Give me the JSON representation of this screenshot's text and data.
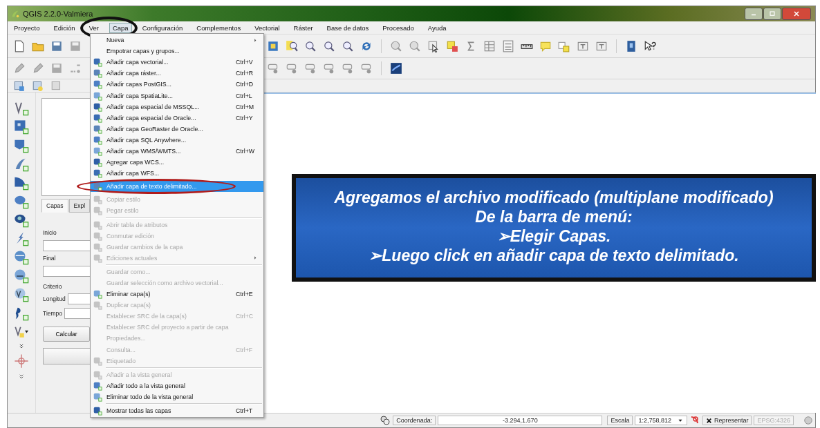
{
  "window": {
    "title": "QGIS 2.2.0-Valmiera"
  },
  "menubar": [
    {
      "label": "Proyecto",
      "selected": false
    },
    {
      "label": "Edición",
      "selected": false
    },
    {
      "label": "Ver",
      "selected": false
    },
    {
      "label": "Capa",
      "selected": true
    },
    {
      "label": "Configuración",
      "selected": false
    },
    {
      "label": "Complementos",
      "selected": false
    },
    {
      "label": "Vectorial",
      "selected": false
    },
    {
      "label": "Ráster",
      "selected": false
    },
    {
      "label": "Base de datos",
      "selected": false
    },
    {
      "label": "Procesado",
      "selected": false
    },
    {
      "label": "Ayuda",
      "selected": false
    }
  ],
  "layer_menu": {
    "items": [
      {
        "kind": "item",
        "label": "Nueva",
        "icon": false,
        "submenu": true,
        "disabled": false,
        "selected": false
      },
      {
        "kind": "item",
        "label": "Empotrar capas y grupos...",
        "icon": false,
        "submenu": false,
        "disabled": false,
        "selected": false
      },
      {
        "kind": "item",
        "label": "Añadir capa vectorial...",
        "shortcut": "Ctrl+V",
        "icon": true,
        "submenu": false,
        "disabled": false,
        "selected": false
      },
      {
        "kind": "item",
        "label": "Añadir capa ráster...",
        "shortcut": "Ctrl+R",
        "icon": true,
        "submenu": false,
        "disabled": false,
        "selected": false
      },
      {
        "kind": "item",
        "label": "Añadir capas PostGIS...",
        "shortcut": "Ctrl+D",
        "icon": true,
        "submenu": false,
        "disabled": false,
        "selected": false
      },
      {
        "kind": "item",
        "label": "Añadir capa SpatiaLite...",
        "shortcut": "Ctrl+L",
        "icon": true,
        "submenu": false,
        "disabled": false,
        "selected": false
      },
      {
        "kind": "item",
        "label": "Añadir capa espacial de MSSQL...",
        "shortcut": "Ctrl+M",
        "icon": true,
        "submenu": false,
        "disabled": false,
        "selected": false
      },
      {
        "kind": "item",
        "label": "Añadir capa espacial de Oracle...",
        "shortcut": "Ctrl+Y",
        "icon": true,
        "submenu": false,
        "disabled": false,
        "selected": false
      },
      {
        "kind": "item",
        "label": "Añadir capa GeoRaster de Oracle...",
        "icon": true,
        "submenu": false,
        "disabled": false,
        "selected": false
      },
      {
        "kind": "item",
        "label": "Añadir capa SQL Anywhere...",
        "icon": true,
        "submenu": false,
        "disabled": false,
        "selected": false
      },
      {
        "kind": "item",
        "label": "Añadir capa WMS/WMTS...",
        "shortcut": "Ctrl+W",
        "icon": true,
        "submenu": false,
        "disabled": false,
        "selected": false
      },
      {
        "kind": "item",
        "label": "Agregar capa WCS...",
        "icon": true,
        "submenu": false,
        "disabled": false,
        "selected": false
      },
      {
        "kind": "item",
        "label": "Añadir capa WFS...",
        "icon": true,
        "submenu": false,
        "disabled": false,
        "selected": false
      },
      {
        "kind": "item",
        "label": "Añadir capa de texto delimitado...",
        "icon": true,
        "submenu": false,
        "disabled": false,
        "selected": true
      },
      {
        "kind": "item",
        "label": "Copiar estilo",
        "icon": true,
        "submenu": false,
        "disabled": true,
        "selected": false
      },
      {
        "kind": "item",
        "label": "Pegar estilo",
        "icon": true,
        "submenu": false,
        "disabled": true,
        "selected": false
      },
      {
        "kind": "separator"
      },
      {
        "kind": "item",
        "label": "Abrir tabla de atributos",
        "icon": true,
        "submenu": false,
        "disabled": true,
        "selected": false
      },
      {
        "kind": "item",
        "label": "Conmutar edición",
        "icon": true,
        "submenu": false,
        "disabled": true,
        "selected": false
      },
      {
        "kind": "item",
        "label": "Guardar cambios de la capa",
        "icon": true,
        "submenu": false,
        "disabled": true,
        "selected": false
      },
      {
        "kind": "item",
        "label": "Ediciones actuales",
        "icon": true,
        "submenu": true,
        "disabled": true,
        "selected": false
      },
      {
        "kind": "separator"
      },
      {
        "kind": "item",
        "label": "Guardar como...",
        "icon": false,
        "submenu": false,
        "disabled": true,
        "selected": false
      },
      {
        "kind": "item",
        "label": "Guardar selección como archivo vectorial...",
        "icon": false,
        "submenu": false,
        "disabled": true,
        "selected": false
      },
      {
        "kind": "item",
        "label": "Eliminar capa(s)",
        "shortcut": "Ctrl+E",
        "icon": true,
        "submenu": false,
        "disabled": false,
        "selected": false
      },
      {
        "kind": "item",
        "label": "Duplicar capa(s)",
        "icon": true,
        "submenu": false,
        "disabled": true,
        "selected": false
      },
      {
        "kind": "item",
        "label": "Establecer SRC de la capa(s)",
        "shortcut": "Ctrl+C",
        "icon": false,
        "submenu": false,
        "disabled": true,
        "selected": false
      },
      {
        "kind": "item",
        "label": "Establecer SRC del proyecto a partir de capa",
        "icon": false,
        "submenu": false,
        "disabled": true,
        "selected": false
      },
      {
        "kind": "item",
        "label": "Propiedades...",
        "icon": false,
        "submenu": false,
        "disabled": true,
        "selected": false
      },
      {
        "kind": "item",
        "label": "Consulta...",
        "shortcut": "Ctrl+F",
        "icon": false,
        "submenu": false,
        "disabled": true,
        "selected": false
      },
      {
        "kind": "item",
        "label": "Etiquetado",
        "icon": true,
        "submenu": false,
        "disabled": true,
        "selected": false
      },
      {
        "kind": "separator"
      },
      {
        "kind": "item",
        "label": "Añadir a la vista general",
        "icon": true,
        "submenu": false,
        "disabled": true,
        "selected": false
      },
      {
        "kind": "item",
        "label": "Añadir todo a la vista general",
        "icon": true,
        "submenu": false,
        "disabled": false,
        "selected": false
      },
      {
        "kind": "item",
        "label": "Eliminar todo de la vista general",
        "icon": true,
        "submenu": false,
        "disabled": false,
        "selected": false
      },
      {
        "kind": "separator"
      },
      {
        "kind": "item",
        "label": "Mostrar todas las capas",
        "shortcut": "Ctrl+T",
        "icon": true,
        "submenu": false,
        "disabled": false,
        "selected": false
      }
    ]
  },
  "side_panel": {
    "tabs": [
      {
        "label": "Capas",
        "selected": true
      },
      {
        "label": "Expl",
        "selected": false
      }
    ],
    "fields": [
      {
        "kind": "stacked",
        "label": "Inicio"
      },
      {
        "kind": "stacked",
        "label": "Final"
      },
      {
        "kind": "heading",
        "label": "Criterio"
      },
      {
        "kind": "inline",
        "label": "Longitud"
      },
      {
        "kind": "inline",
        "label": "Tiempo"
      }
    ],
    "buttons": [
      "Calcular"
    ]
  },
  "callout": {
    "lines": [
      {
        "kind": "plain",
        "text": "Agregamos el archivo modificado (multiplane modificado)"
      },
      {
        "kind": "plain",
        "text": "De la barra de menú:"
      },
      {
        "kind": "bullet",
        "marker": "➢",
        "text": "Elegir Capas."
      },
      {
        "kind": "bullet",
        "marker": "➢",
        "text": "Luego click en añadir capa de texto delimitado."
      }
    ]
  },
  "status_bar": {
    "coordinate_label": "Coordenada:",
    "coordinate_value": "-3.294,1.670",
    "scale_label": "Escala",
    "scale_value": "1:2,758,812",
    "render": {
      "label": "Representar",
      "checked": true
    },
    "crs": "EPSG:4326"
  }
}
